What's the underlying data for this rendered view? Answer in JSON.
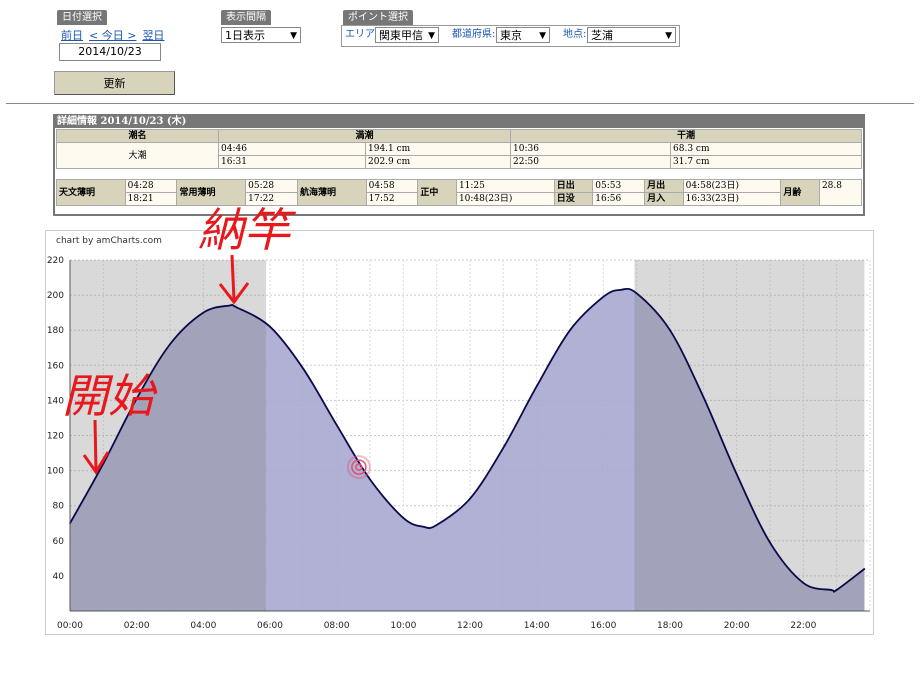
{
  "date_panel": {
    "title": "日付選択",
    "prev": "前日",
    "today": "< 今日 >",
    "next": "翌日",
    "date": "2014/10/23"
  },
  "interval_panel": {
    "title": "表示間隔",
    "selected": "1日表示"
  },
  "point_panel": {
    "title": "ポイント選択",
    "area_label": "エリア:",
    "area": "関東甲信",
    "pref_label": "都道府県:",
    "pref": "東京",
    "spot_label": "地点:",
    "spot": "芝浦"
  },
  "update_button": "更新",
  "detail": {
    "title": "詳細情報  2014/10/23 (木)",
    "headers": {
      "tide_name": "潮名",
      "high": "満潮",
      "low": "干潮"
    },
    "tide_name": "大潮",
    "high_rows": [
      {
        "time": "04:46",
        "height": "194.1 cm"
      },
      {
        "time": "16:31",
        "height": "202.9 cm"
      }
    ],
    "low_rows": [
      {
        "time": "10:36",
        "height": "68.3 cm"
      },
      {
        "time": "22:50",
        "height": "31.7 cm"
      }
    ],
    "sun": {
      "astro_label": "天文薄明",
      "astro_1": "04:28",
      "astro_2": "18:21",
      "civil_label": "常用薄明",
      "civil_1": "05:28",
      "civil_2": "17:22",
      "nautical_label": "航海薄明",
      "nautical_1": "04:58",
      "nautical_2": "17:52",
      "transit_label": "正中",
      "transit_1": "11:25",
      "transit_2": "10:48(23日)",
      "sunrise_label": "日出",
      "sunrise": "05:53",
      "sunset_label": "日没",
      "sunset": "16:56",
      "moonrise_label": "月出",
      "moonrise": "04:58(23日)",
      "moonset_label": "月入",
      "moonset": "16:33(23日)",
      "age_label": "月齢",
      "age": "28.8"
    }
  },
  "chart_credit": "chart by amCharts.com",
  "annotations": {
    "start": "開始",
    "end": "納竿"
  },
  "colors": {
    "fill": "#a9a9d0",
    "line": "#0a0a4a",
    "shade": "#d0d0d0",
    "marker": "#e05070"
  },
  "chart_data": {
    "type": "area",
    "x": [
      "00:00",
      "01:00",
      "02:00",
      "03:00",
      "04:00",
      "04:46",
      "05:00",
      "06:00",
      "07:00",
      "08:00",
      "09:00",
      "10:00",
      "10:36",
      "11:00",
      "12:00",
      "13:00",
      "14:00",
      "15:00",
      "16:00",
      "16:31",
      "17:00",
      "18:00",
      "19:00",
      "20:00",
      "21:00",
      "22:00",
      "22:50",
      "23:00",
      "23:50"
    ],
    "series": [
      {
        "values": [
          70,
          104,
          141,
          172,
          190,
          194,
          193,
          182,
          158,
          126,
          95,
          73,
          68,
          69,
          84,
          113,
          148,
          180,
          199,
          203,
          201,
          180,
          142,
          98,
          59,
          36,
          32,
          32,
          44
        ]
      }
    ],
    "xticks": [
      "00:00",
      "02:00",
      "04:00",
      "06:00",
      "08:00",
      "10:00",
      "12:00",
      "14:00",
      "16:00",
      "18:00",
      "20:00",
      "22:00"
    ],
    "yticks": [
      40,
      60,
      80,
      100,
      120,
      140,
      160,
      180,
      200,
      220
    ],
    "ylim": [
      20,
      220
    ],
    "night_shading": [
      [
        "00:00",
        "05:53"
      ],
      [
        "16:56",
        "23:50"
      ]
    ],
    "current_marker": {
      "x": "08:40",
      "y": 102
    }
  }
}
